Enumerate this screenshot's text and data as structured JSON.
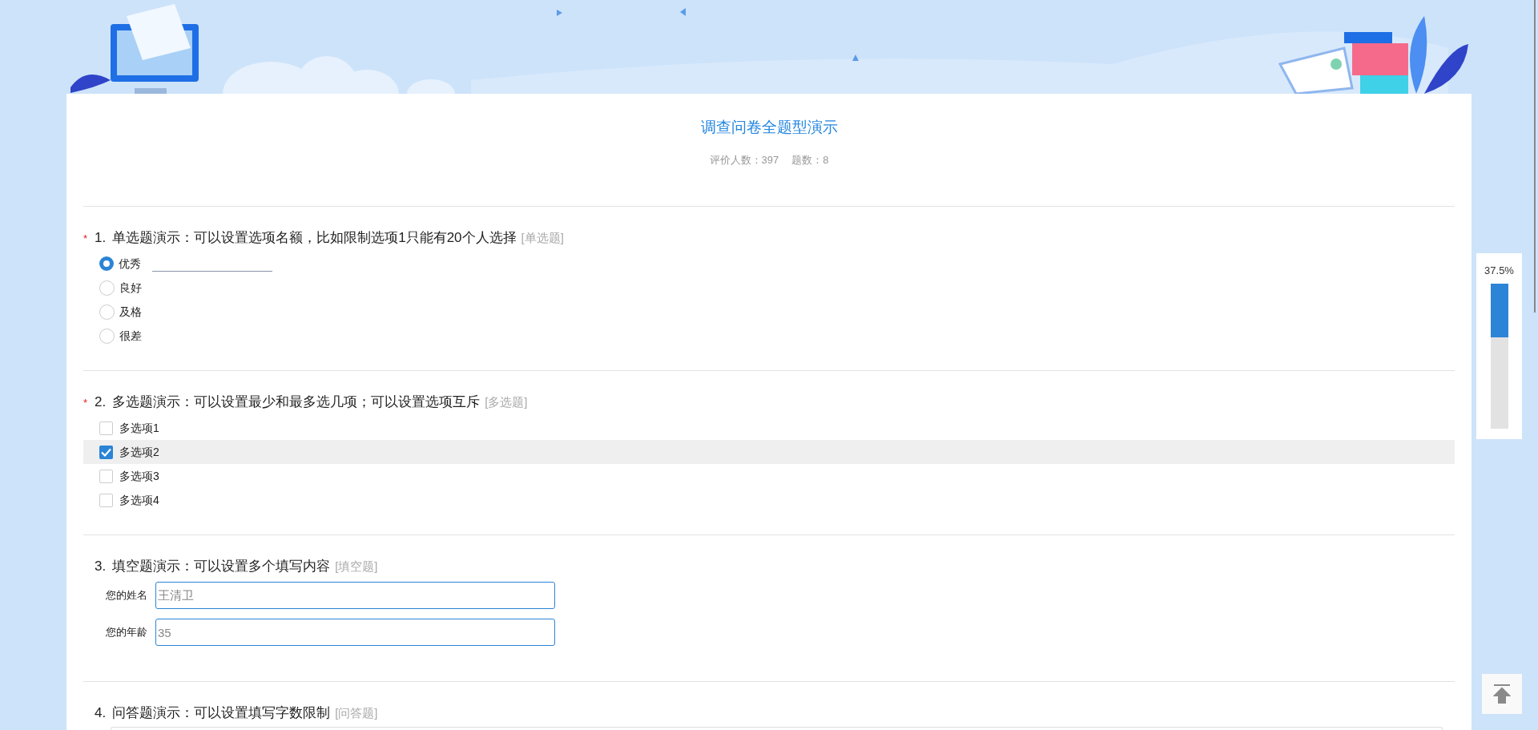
{
  "survey": {
    "title": "调查问卷全题型演示",
    "respondents_label": "评价人数：",
    "respondents": "397",
    "question_count_label": "题数：",
    "question_count": "8"
  },
  "questions": [
    {
      "kind": "single",
      "required_mark": "*",
      "number": "1.",
      "text": "单选题演示：可以设置选项名额，比如限制选项1只能有20个人选择",
      "type_tag": "[单选题]",
      "options": [
        {
          "label": "优秀",
          "selected": true,
          "fill_in": true
        },
        {
          "label": "良好",
          "selected": false,
          "fill_in": false
        },
        {
          "label": "及格",
          "selected": false,
          "fill_in": false
        },
        {
          "label": "很差",
          "selected": false,
          "fill_in": false
        }
      ]
    },
    {
      "kind": "multi",
      "required_mark": "*",
      "number": "2.",
      "text": "多选题演示：可以设置最少和最多选几项；可以设置选项互斥",
      "type_tag": "[多选题]",
      "options": [
        {
          "label": "多选项1",
          "checked": false
        },
        {
          "label": "多选项2",
          "checked": true
        },
        {
          "label": "多选项3",
          "checked": false
        },
        {
          "label": "多选项4",
          "checked": false
        }
      ]
    },
    {
      "kind": "fill",
      "number": "3.",
      "text": "填空题演示：可以设置多个填写内容",
      "type_tag": "[填空题]",
      "fields": [
        {
          "label": "您的姓名",
          "value": "王清卫"
        },
        {
          "label": "您的年龄",
          "value": "35"
        }
      ]
    },
    {
      "kind": "essay",
      "number": "4.",
      "text": "问答题演示：可以设置填写字数限制",
      "type_tag": "[问答题]"
    }
  ],
  "progress": {
    "reading": "37.5%",
    "level": 0.375
  }
}
